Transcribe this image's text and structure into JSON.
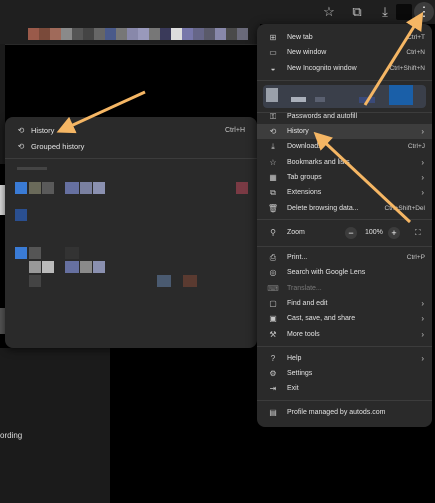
{
  "toolbar": {
    "icons": [
      "star-icon",
      "extensions-icon",
      "download-icon",
      "profile-avatar",
      "kebab-menu-icon"
    ],
    "bookmark_colors": [
      "#9a5a4a",
      "#7a4a3a",
      "#a06a5a",
      "#8a8a8a",
      "#555",
      "#444",
      "#666",
      "#4a5a8a",
      "#777",
      "#8888aa",
      "#9999bb",
      "#777",
      "#3a3a5a",
      "#ddd",
      "#7777aa",
      "#666688",
      "#5a5a6a",
      "#8888aa",
      "#4a4a4a",
      "#6a6a7a"
    ]
  },
  "history_menu": {
    "items": [
      {
        "icon": "history-icon",
        "label": "History",
        "shortcut": "Ctrl+H"
      },
      {
        "icon": "grouped-history-icon",
        "label": "Grouped history",
        "shortcut": ""
      }
    ]
  },
  "menu": {
    "items": [
      {
        "icon": "new-tab-icon",
        "label": "New tab",
        "shortcut": "Ctrl+T"
      },
      {
        "icon": "new-window-icon",
        "label": "New window",
        "shortcut": "Ctrl+N"
      },
      {
        "icon": "incognito-icon",
        "label": "New Incognito window",
        "shortcut": "Ctrl+Shift+N"
      },
      {
        "icon": "key-icon",
        "label": "Passwords and autofill",
        "shortcut": ""
      },
      {
        "icon": "history-icon",
        "label": "History",
        "shortcut": ""
      },
      {
        "icon": "download-icon",
        "label": "Downloads",
        "shortcut": "Ctrl+J"
      },
      {
        "icon": "star-icon",
        "label": "Bookmarks and lists",
        "shortcut": ""
      },
      {
        "icon": "tab-groups-icon",
        "label": "Tab groups",
        "shortcut": ""
      },
      {
        "icon": "extensions-icon",
        "label": "Extensions",
        "shortcut": ""
      },
      {
        "icon": "trash-icon",
        "label": "Delete browsing data...",
        "shortcut": "Ctrl+Shift+Del"
      },
      {
        "icon": "zoom-icon",
        "label": "Zoom",
        "shortcut": ""
      },
      {
        "icon": "print-icon",
        "label": "Print...",
        "shortcut": "Ctrl+P"
      },
      {
        "icon": "lens-icon",
        "label": "Search with Google Lens",
        "shortcut": ""
      },
      {
        "icon": "translate-icon",
        "label": "Translate...",
        "shortcut": ""
      },
      {
        "icon": "find-icon",
        "label": "Find and edit",
        "shortcut": ""
      },
      {
        "icon": "cast-icon",
        "label": "Cast, save, and share",
        "shortcut": ""
      },
      {
        "icon": "more-tools-icon",
        "label": "More tools",
        "shortcut": ""
      },
      {
        "icon": "help-icon",
        "label": "Help",
        "shortcut": ""
      },
      {
        "icon": "settings-icon",
        "label": "Settings",
        "shortcut": ""
      },
      {
        "icon": "exit-icon",
        "label": "Exit",
        "shortcut": ""
      },
      {
        "icon": "managed-icon",
        "label": "Profile managed by autods.com",
        "shortcut": ""
      }
    ],
    "zoom": {
      "minus": "−",
      "value": "100%",
      "plus": "+"
    }
  },
  "background": {
    "lower_text": "ording"
  },
  "colors": {
    "menu_bg": "#2a2a2a",
    "highlight": "#3d3d3d",
    "arrow": "#f5b664"
  }
}
